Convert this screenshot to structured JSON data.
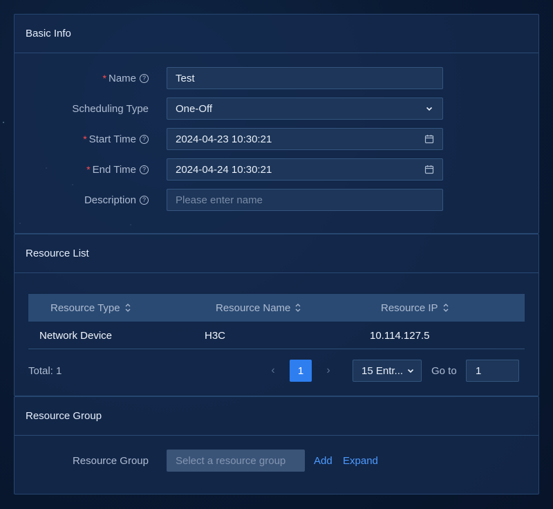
{
  "basic_info": {
    "title": "Basic Info",
    "fields": {
      "name": {
        "label": "Name",
        "value": "Test"
      },
      "scheduling_type": {
        "label": "Scheduling Type",
        "value": "One-Off"
      },
      "start_time": {
        "label": "Start Time",
        "value": "2024-04-23 10:30:21"
      },
      "end_time": {
        "label": "End Time",
        "value": "2024-04-24 10:30:21"
      },
      "description": {
        "label": "Description",
        "placeholder": "Please enter name"
      }
    }
  },
  "resource_list": {
    "title": "Resource List",
    "columns": [
      "Resource Type",
      "Resource Name",
      "Resource IP"
    ],
    "rows": [
      [
        "Network Device",
        "H3C",
        "10.114.127.5"
      ]
    ],
    "pagination": {
      "total": "Total: 1",
      "current_page": "1",
      "page_size": "15 Entr...",
      "goto_label": "Go to",
      "goto_value": "1"
    }
  },
  "resource_group": {
    "title": "Resource Group",
    "label": "Resource Group",
    "placeholder": "Select a resource group",
    "add_label": "Add",
    "expand_label": "Expand"
  },
  "colors": {
    "accent": "#2e7ef0",
    "link": "#4d9bff",
    "required": "#ff4d4f"
  },
  "icons": [
    "help-icon",
    "chevron-down-icon",
    "calendar-icon",
    "sort-icon",
    "chevron-left-icon",
    "chevron-right-icon"
  ]
}
